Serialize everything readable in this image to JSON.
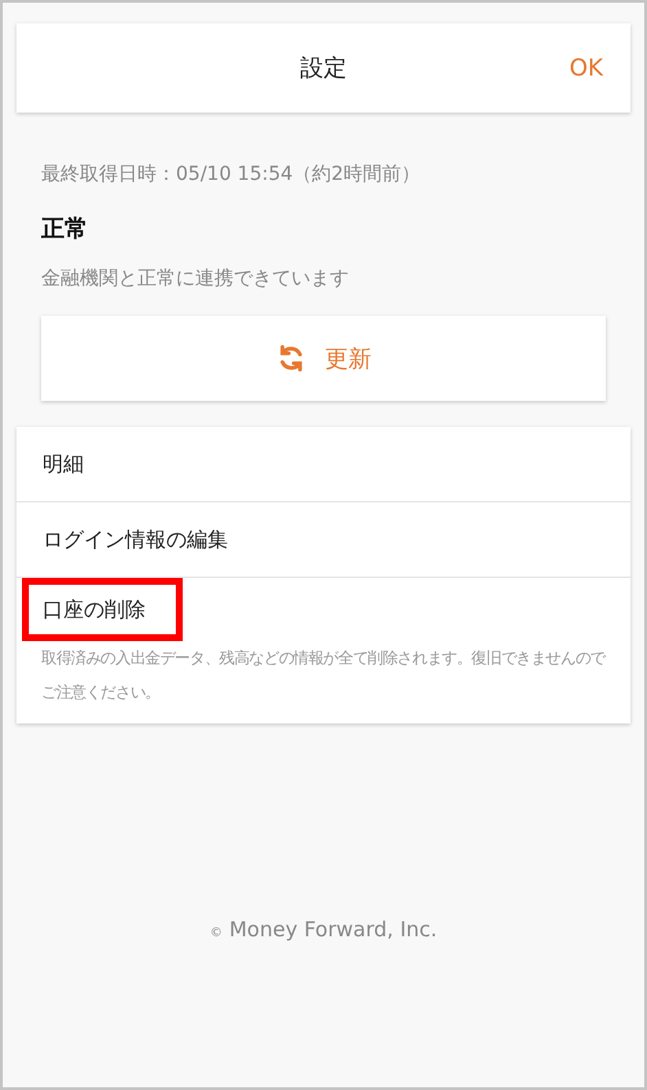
{
  "header": {
    "title": "設定",
    "action": "OK"
  },
  "status": {
    "last_fetched": "最終取得日時：05/10 15:54（約2時間前）",
    "state": "正常",
    "message": "金融機関と正常に連携できています"
  },
  "update_button": {
    "label": "更新"
  },
  "menu": [
    {
      "label": "明細",
      "highlighted": false
    },
    {
      "label": "ログイン情報の編集",
      "highlighted": false
    },
    {
      "label": "口座の削除",
      "highlighted": true,
      "note": "取得済みの入出金データ、残高などの情報が全て削除されます。復旧できませんのでご注意ください。"
    }
  ],
  "footer": {
    "copyright": "©",
    "company": "Money Forward, Inc."
  }
}
